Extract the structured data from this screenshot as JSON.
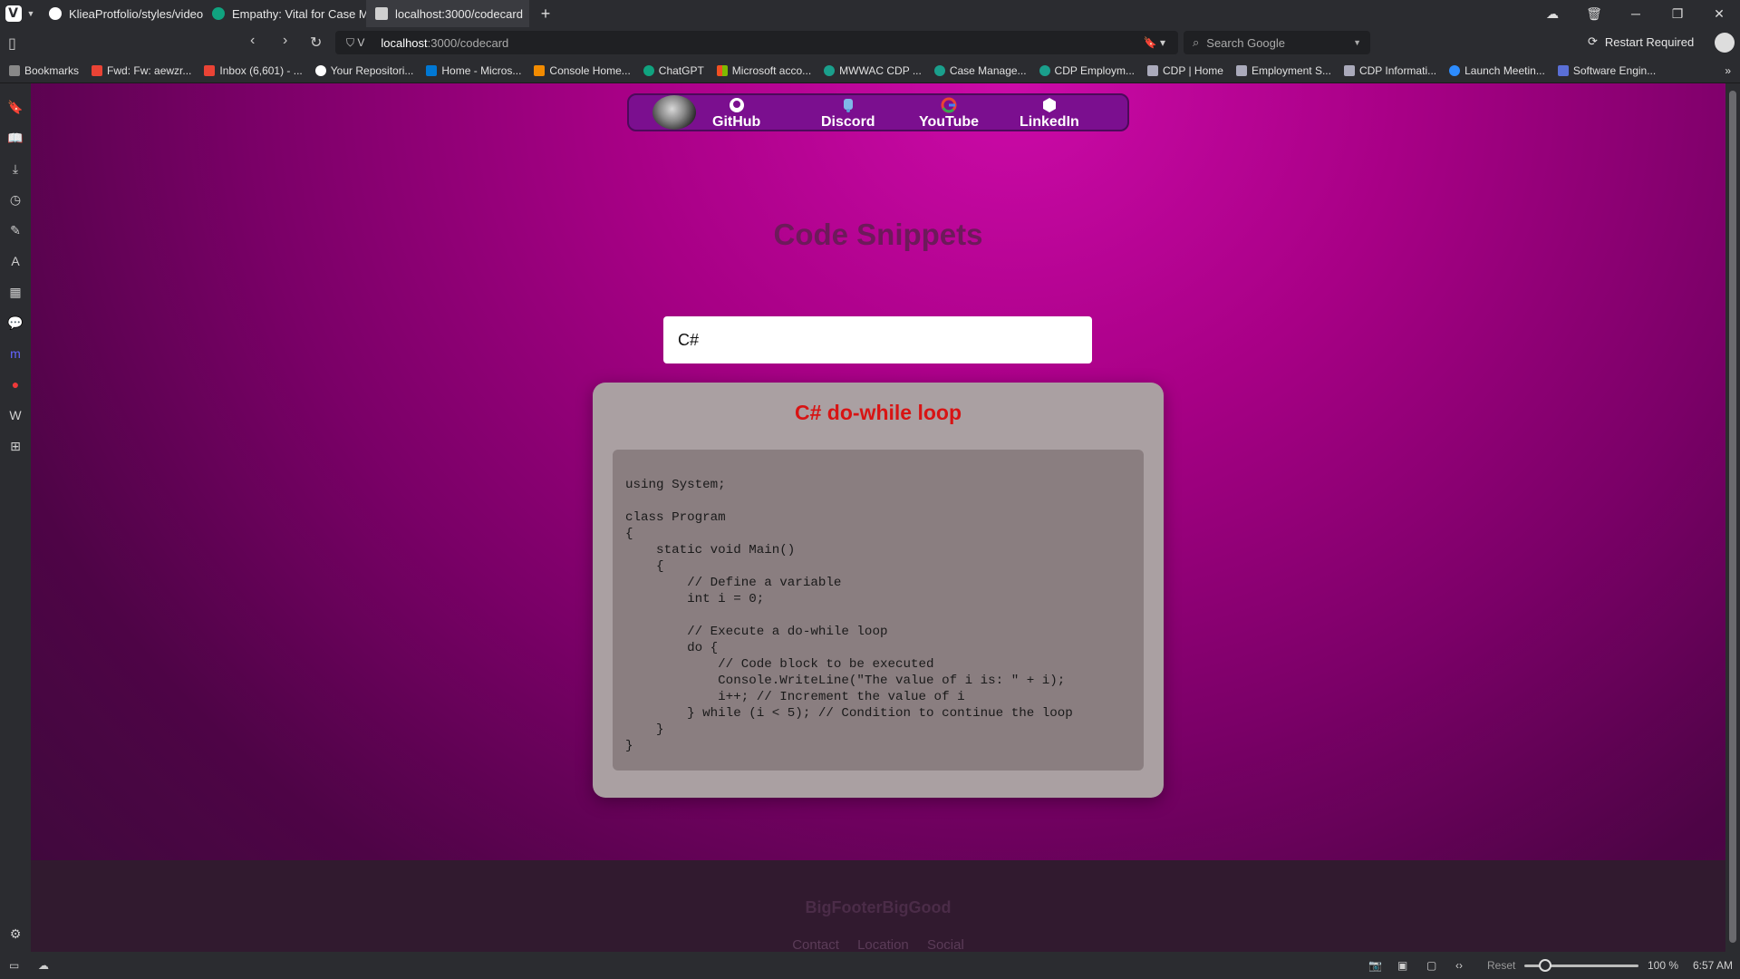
{
  "browser": {
    "tabs": [
      {
        "title": "KlieaProtfolio/styles/video.r",
        "icon": "github-icon"
      },
      {
        "title": "Empathy: Vital for Case Ma",
        "icon": "chatgpt-icon"
      },
      {
        "title": "localhost:3000/codecard",
        "icon": "page-icon"
      }
    ],
    "url_host": "localhost",
    "url_path": ":3000/codecard",
    "search_placeholder": "Search Google",
    "restart_label": "Restart Required",
    "bookmarks": [
      "Bookmarks",
      "Fwd: Fw: aewzr...",
      "Inbox (6,601) - ...",
      "Your Repositori...",
      "Home - Micros...",
      "Console Home...",
      "ChatGPT",
      "Microsoft acco...",
      "MWWAC CDP ...",
      "Case Manage...",
      "CDP Employm...",
      "CDP | Home",
      "Employment S...",
      "CDP Informati...",
      "Launch Meetin...",
      "Software Engin..."
    ]
  },
  "nav": {
    "items": [
      {
        "label": "GitHub",
        "icon": "github-icon"
      },
      {
        "label": "Discord",
        "icon": "discord-icon"
      },
      {
        "label": "YouTube",
        "icon": "google-icon"
      },
      {
        "label": "LinkedIn",
        "icon": "linkedin-icon"
      }
    ]
  },
  "page": {
    "title": "Code Snippets",
    "search_value": "C#"
  },
  "card": {
    "title": "C# do-while loop",
    "code": "using System;\n\nclass Program\n{\n    static void Main()\n    {\n        // Define a variable\n        int i = 0;\n\n        // Execute a do-while loop\n        do {\n            // Code block to be executed\n            Console.WriteLine(\"The value of i is: \" + i);\n            i++; // Increment the value of i\n        } while (i < 5); // Condition to continue the loop\n    }\n}"
  },
  "footer": {
    "brand": "BigFooterBigGood",
    "links": [
      "Contact",
      "Location",
      "Social"
    ]
  },
  "statusbar": {
    "reset_label": "Reset",
    "zoom": "100 %",
    "time": "6:57 AM"
  }
}
